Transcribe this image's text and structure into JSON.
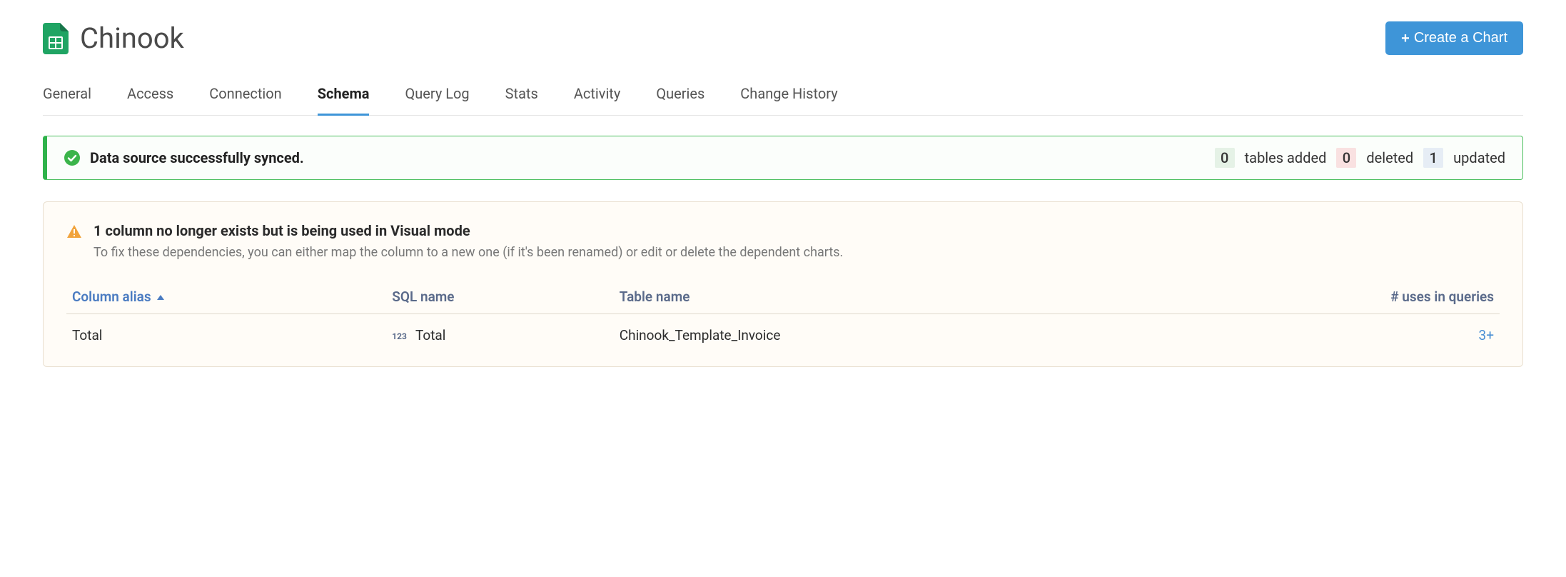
{
  "header": {
    "title": "Chinook",
    "create_button": "Create a Chart"
  },
  "tabs": [
    {
      "label": "General",
      "active": false
    },
    {
      "label": "Access",
      "active": false
    },
    {
      "label": "Connection",
      "active": false
    },
    {
      "label": "Schema",
      "active": true
    },
    {
      "label": "Query Log",
      "active": false
    },
    {
      "label": "Stats",
      "active": false
    },
    {
      "label": "Activity",
      "active": false
    },
    {
      "label": "Queries",
      "active": false
    },
    {
      "label": "Change History",
      "active": false
    }
  ],
  "sync_alert": {
    "message": "Data source successfully synced.",
    "added_count": "0",
    "added_label": "tables added",
    "deleted_count": "0",
    "deleted_label": "deleted",
    "updated_count": "1",
    "updated_label": "updated"
  },
  "warning": {
    "title": "1 column no longer exists but is being used in Visual mode",
    "subtitle": "To fix these dependencies, you can either map the column to a new one (if it's been renamed) or edit or delete the dependent charts.",
    "columns": {
      "alias": "Column alias",
      "sql": "SQL name",
      "table": "Table name",
      "uses": "# uses in queries"
    },
    "rows": [
      {
        "alias": "Total",
        "type_badge": "123",
        "sql_name": "Total",
        "table_name": "Chinook_Template_Invoice",
        "uses": "3+"
      }
    ]
  }
}
